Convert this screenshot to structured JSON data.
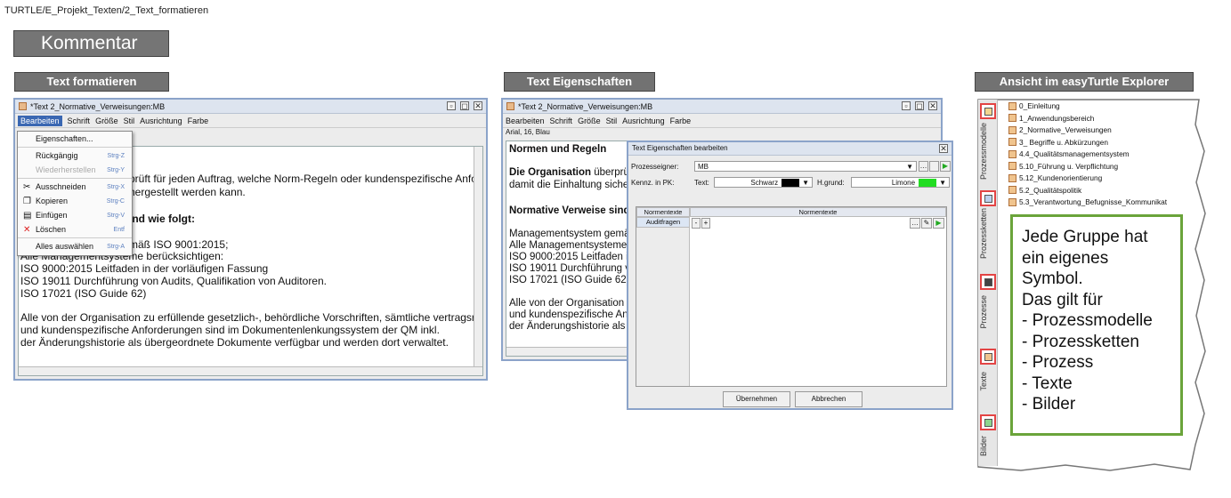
{
  "breadcrumb": "TURTLE/E_Projekt_Texten/2_Text_formatieren",
  "kommentar_label": "Kommentar",
  "sections": {
    "left": "Text formatieren",
    "mid": "Text Eigenschaften",
    "right": "Ansicht im easyTurtle Explorer"
  },
  "left_window": {
    "title": "*Text 2_Normative_Verweisungen:MB",
    "menu": [
      "Bearbeiten",
      "Schrift",
      "Größe",
      "Stil",
      "Ausrichtung",
      "Farbe"
    ],
    "context_menu": [
      {
        "label": "Eigenschaften...",
        "shortcut": "",
        "icon": ""
      },
      {
        "label": "Rückgängig",
        "shortcut": "Strg-Z",
        "icon": ""
      },
      {
        "label": "Wiederherstellen",
        "shortcut": "Strg-Y",
        "icon": ""
      },
      {
        "label": "Ausschneiden",
        "shortcut": "Strg-X",
        "icon": "✂"
      },
      {
        "label": "Kopieren",
        "shortcut": "Strg-C",
        "icon": "❐"
      },
      {
        "label": "Einfügen",
        "shortcut": "Strg-V",
        "icon": "▤"
      },
      {
        "label": "Löschen",
        "shortcut": "Entf",
        "icon": "✕"
      },
      {
        "label": "Alles auswählen",
        "shortcut": "Strg-A",
        "icon": ""
      }
    ],
    "lines": [
      "prüft für jeden Auftrag, welche Norm-Regeln oder kundenspezifische Anfo",
      "hergestellt werden kann.",
      "ind wie folgt:",
      "mäß ISO 9001:2015;",
      "Alle Managementsysteme berücksichtigen:",
      "ISO 9000:2015 Leitfaden in der vorläufigen Fassung",
      "ISO 19011 Durchführung von Audits, Qualifikation von Auditoren.",
      "ISO 17021 (ISO Guide 62)",
      "Alle von der Organisation zu erfüllende gesetzlich-, behördliche Vorschriften, sämtliche vertragsre",
      "und kundenspezifische Anforderungen sind im Dokumentenlenkungssystem der QM inkl.",
      "der Änderungshistorie als übergeordnete Dokumente verfügbar und werden dort verwaltet."
    ]
  },
  "mid_window": {
    "title": "*Text 2_Normative_Verweisungen:MB",
    "menu": [
      "Bearbeiten",
      "Schrift",
      "Größe",
      "Stil",
      "Ausrichtung",
      "Farbe"
    ],
    "font_status": "Arial, 16, Blau",
    "heading1": "Normen und Regeln",
    "org_bold": "Die Organisation",
    "org_rest": "überprüf",
    "line2": "damit die Einhaltung sicher",
    "heading2": "Normative Verweise sind",
    "lines": [
      "Managementsystem gemäß",
      "Alle Managementsysteme b",
      "ISO 9000:2015 Leitfaden in",
      "ISO 19011 Durchführung vo",
      "ISO 17021 (ISO Guide 62)",
      "Alle von der Organisation zu",
      "und kundenspezifische Anfo",
      "der Änderungshistorie als ü"
    ]
  },
  "dialog": {
    "title": "Text Eigenschaften bearbeiten",
    "owner_label": "Prozesseigner:",
    "owner_value": "MB",
    "pk_label": "Kennz. in PK:",
    "text_label": "Text:",
    "text_color": "Schwarz",
    "bg_label": "H.grund:",
    "bg_color": "Limone",
    "col1": "Normentexte",
    "col2": "Normentexte",
    "row_label": "Auditfragen",
    "ok": "Übernehmen",
    "cancel": "Abbrechen",
    "colors": {
      "black": "#000000",
      "lime": "#22dd22"
    }
  },
  "explorer": {
    "tabs": [
      "Prozessmodelle",
      "Prozessketten",
      "Prozesse",
      "Texte",
      "Bilder"
    ],
    "items": [
      "0_Einleitung",
      "1_Anwendungsbereich",
      "2_Normative_Verweisungen",
      "3_ Begriffe u. Abkürzungen",
      "4.4_Qualitätsmanagementsystem",
      "5.10_Führung u. Verpflichtung",
      "5.12_Kundenorientierung",
      "5.2_Qualitätspolitik",
      "5.3_Verantwortung_Befugnisse_Kommunikat"
    ],
    "note_lines": [
      "Jede Gruppe hat",
      "ein eigenes",
      "Symbol.",
      "Das gilt für",
      "- Prozessmodelle",
      "- Prozessketten",
      "- Prozess",
      "- Texte",
      "- Bilder"
    ]
  }
}
